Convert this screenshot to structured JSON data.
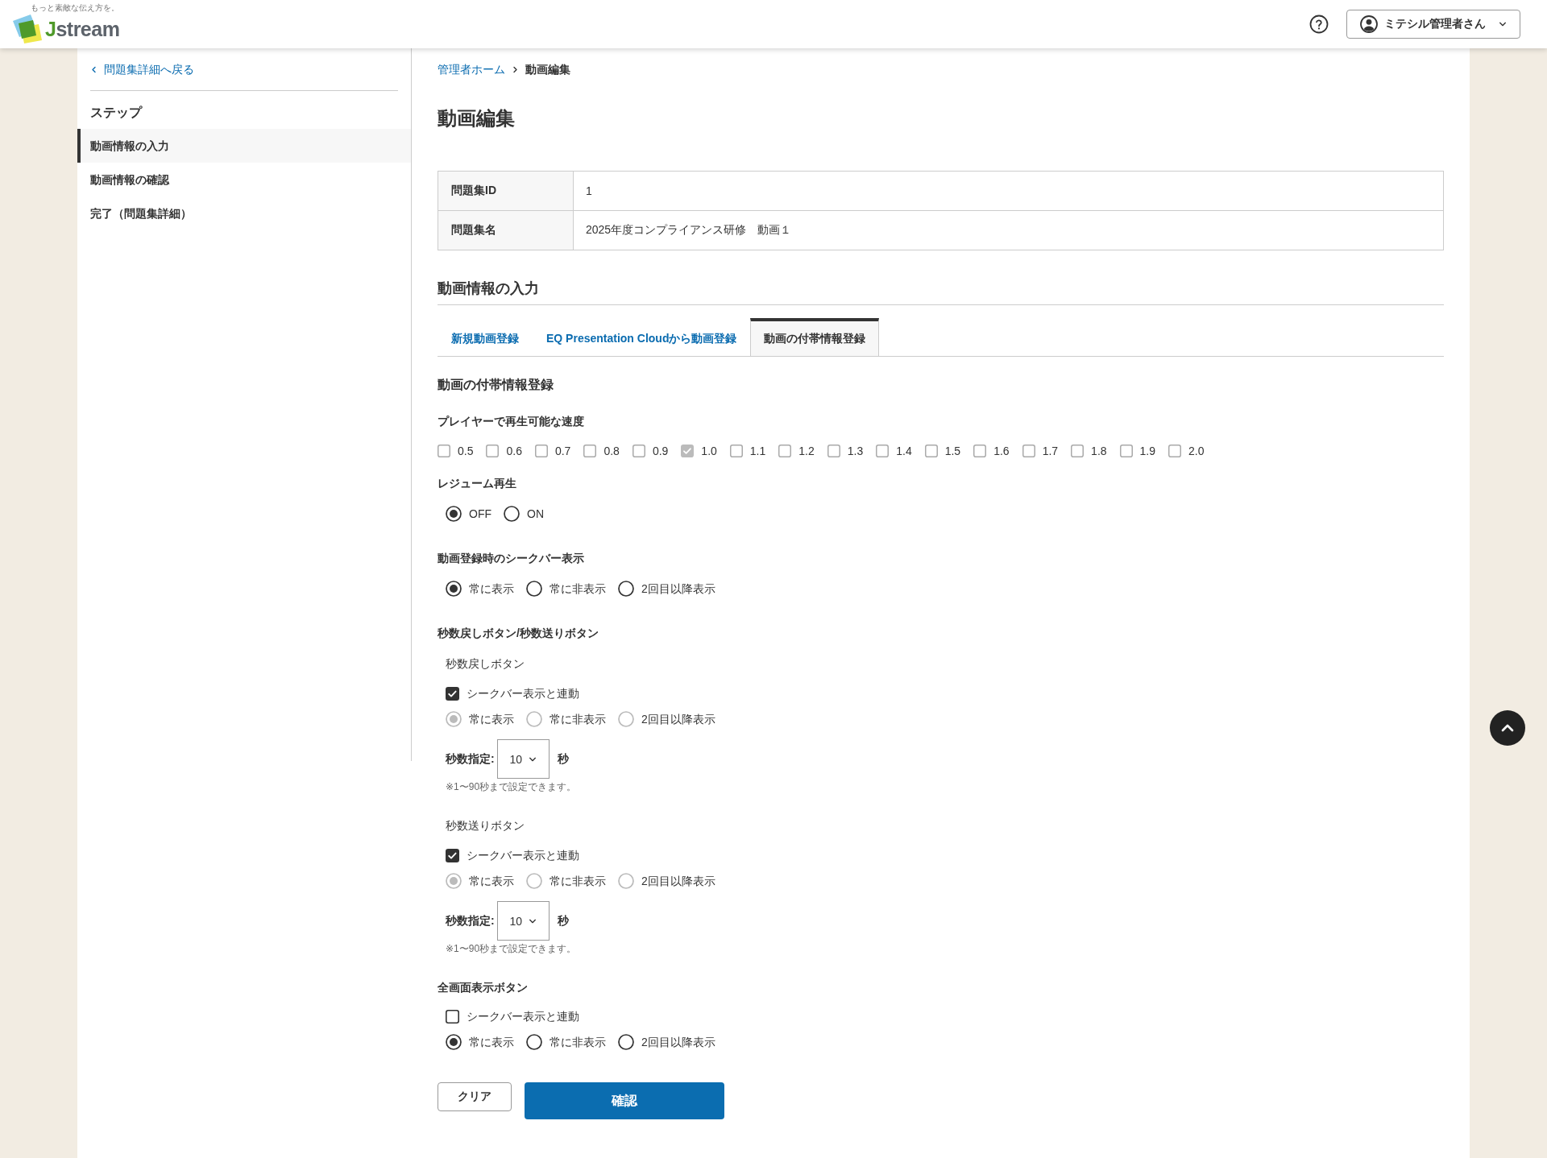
{
  "header": {
    "logo": {
      "tagline": "もっと素敵な伝え方を。",
      "name": "Jstream"
    },
    "user_menu": {
      "label": "ミテシル管理者さん"
    }
  },
  "sidebar": {
    "back_link": "問題集詳細へ戻る",
    "steps_title": "ステップ",
    "steps": [
      {
        "label": "動画情報の入力",
        "selected": true
      },
      {
        "label": "動画情報の確認",
        "selected": false
      },
      {
        "label": "完了（問題集詳細）",
        "selected": false
      }
    ]
  },
  "breadcrumb": [
    {
      "label": "管理者ホーム",
      "kind": "link"
    },
    {
      "label": "動画編集",
      "kind": "current"
    }
  ],
  "page_title": "動画編集",
  "info_table": {
    "rows": [
      {
        "label": "問題集ID",
        "value": "1"
      },
      {
        "label": "問題集名",
        "value": "2025年度コンプライアンス研修　動画１"
      }
    ]
  },
  "section_title": "動画情報の入力",
  "tabs": [
    {
      "label": "新規動画登録",
      "selected": false
    },
    {
      "label": "EQ Presentation Cloudから動画登録",
      "selected": false
    },
    {
      "label": "動画の付帯情報登録",
      "selected": true
    }
  ],
  "form": {
    "title": "動画の付帯情報登録",
    "speeds": {
      "label": "プレイヤーで再生可能な速度",
      "options": [
        {
          "label": "0.5",
          "checked": false
        },
        {
          "label": "0.6",
          "checked": false
        },
        {
          "label": "0.7",
          "checked": false
        },
        {
          "label": "0.8",
          "checked": false
        },
        {
          "label": "0.9",
          "checked": false
        },
        {
          "label": "1.0",
          "checked": true
        },
        {
          "label": "1.1",
          "checked": false
        },
        {
          "label": "1.2",
          "checked": false
        },
        {
          "label": "1.3",
          "checked": false
        },
        {
          "label": "1.4",
          "checked": false
        },
        {
          "label": "1.5",
          "checked": false
        },
        {
          "label": "1.6",
          "checked": false
        },
        {
          "label": "1.7",
          "checked": false
        },
        {
          "label": "1.8",
          "checked": false
        },
        {
          "label": "1.9",
          "checked": false
        },
        {
          "label": "2.0",
          "checked": false
        }
      ]
    },
    "resume": {
      "label": "レジューム再生",
      "options": [
        {
          "label": "OFF",
          "selected": true
        },
        {
          "label": "ON",
          "selected": false
        }
      ]
    },
    "seekbar": {
      "label": "動画登録時のシークバー表示",
      "options": [
        {
          "label": "常に表示",
          "selected": true
        },
        {
          "label": "常に非表示",
          "selected": false
        },
        {
          "label": "2回目以降表示",
          "selected": false
        }
      ]
    },
    "skip_buttons": {
      "label": "秒数戻しボタン/秒数送りボタン",
      "groups": [
        {
          "title": "秒数戻しボタン",
          "link": {
            "label": "シークバー表示と連動",
            "checked": true
          },
          "options": [
            {
              "label": "常に表示",
              "selected": true,
              "disabled": true
            },
            {
              "label": "常に非表示",
              "selected": false,
              "disabled": true
            },
            {
              "label": "2回目以降表示",
              "selected": false,
              "disabled": true
            }
          ],
          "seconds": {
            "label": "秒数指定:",
            "value": "10",
            "unit": "秒"
          },
          "note": "※1〜90秒まで設定できます。"
        },
        {
          "title": "秒数送りボタン",
          "link": {
            "label": "シークバー表示と連動",
            "checked": true
          },
          "options": [
            {
              "label": "常に表示",
              "selected": true,
              "disabled": true
            },
            {
              "label": "常に非表示",
              "selected": false,
              "disabled": true
            },
            {
              "label": "2回目以降表示",
              "selected": false,
              "disabled": true
            }
          ],
          "seconds": {
            "label": "秒数指定:",
            "value": "10",
            "unit": "秒"
          },
          "note": "※1〜90秒まで設定できます。"
        }
      ]
    },
    "fullscreen_button": {
      "label": "全画面表示ボタン",
      "link": {
        "label": "シークバー表示と連動",
        "checked": false
      },
      "options": [
        {
          "label": "常に表示",
          "selected": true,
          "disabled": false
        },
        {
          "label": "常に非表示",
          "selected": false,
          "disabled": false
        },
        {
          "label": "2回目以降表示",
          "selected": false,
          "disabled": false
        }
      ]
    }
  },
  "buttons": [
    {
      "label": "クリア",
      "kind": "secondary"
    },
    {
      "label": "確認",
      "kind": "primary"
    }
  ]
}
